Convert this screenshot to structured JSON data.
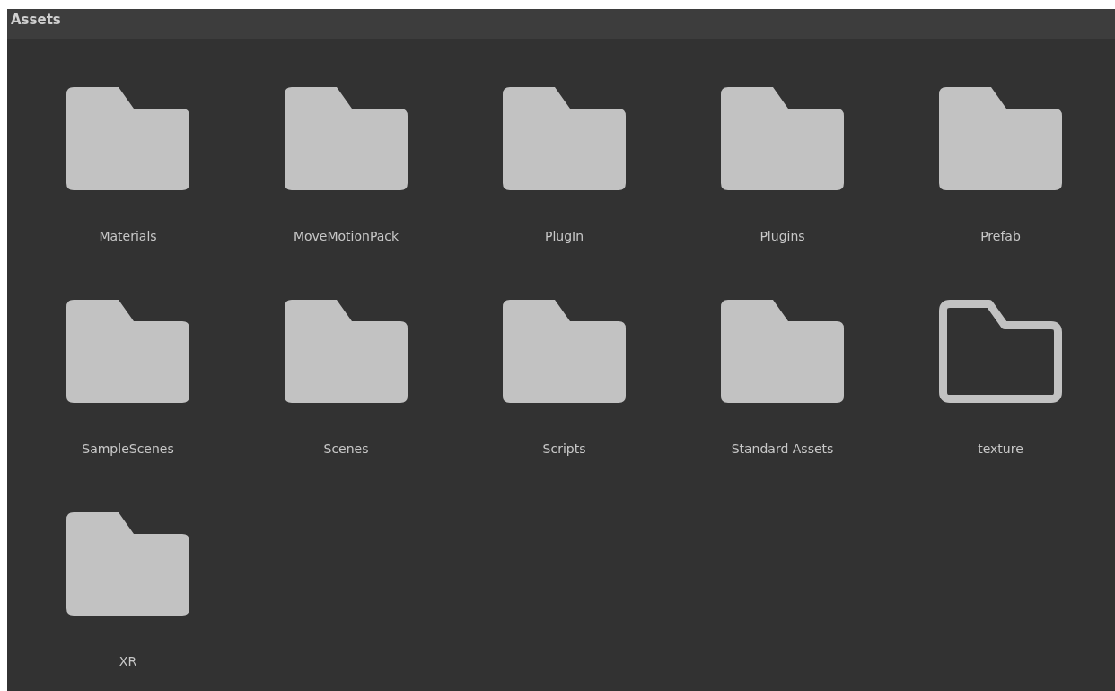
{
  "panel": {
    "title": "Assets"
  },
  "folders": [
    {
      "name": "Materials",
      "empty": false
    },
    {
      "name": "MoveMotionPack",
      "empty": false
    },
    {
      "name": "PlugIn",
      "empty": false
    },
    {
      "name": "Plugins",
      "empty": false
    },
    {
      "name": "Prefab",
      "empty": false
    },
    {
      "name": "SampleScenes",
      "empty": false
    },
    {
      "name": "Scenes",
      "empty": false
    },
    {
      "name": "Scripts",
      "empty": false
    },
    {
      "name": "Standard Assets",
      "empty": false
    },
    {
      "name": "texture",
      "empty": true
    },
    {
      "name": "XR",
      "empty": false
    }
  ]
}
